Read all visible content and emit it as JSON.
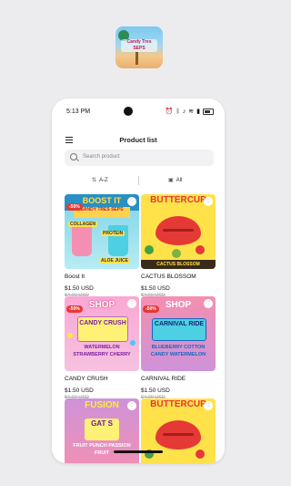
{
  "app_icon": {
    "label": "Candy Tres SEPS"
  },
  "status": {
    "time": "5:13 PM"
  },
  "header": {
    "title": "Product list"
  },
  "search": {
    "placeholder": "Search product"
  },
  "filters": {
    "sort_label": "A-Z",
    "category_label": "All"
  },
  "products": [
    {
      "name": "Boost It",
      "price": "$1.50 USD",
      "old_price": "$4.00 USD",
      "badge": "-50%",
      "art": {
        "header": "BOOST IT",
        "sub": "SANDY TRES SEPS",
        "labels": [
          "COLLAGEN",
          "PROTEIN",
          "ALOE JUICE"
        ]
      }
    },
    {
      "name": "CACTUS BLOSSOM",
      "price": "$1.50 USD",
      "old_price": "$4.00 USD",
      "badge": "",
      "art": {
        "header": "BUTTERCUP",
        "footer": "CACTUS BLOSSOM"
      }
    },
    {
      "name": "CANDY CRUSH",
      "price": "$1.50 USD",
      "old_price": "$4.00 USD",
      "badge": "-50%",
      "art": {
        "header": "SHOP",
        "box": "CANDY CRUSH",
        "flavors": "WATERMELON STRAWBERRY CHERRY"
      }
    },
    {
      "name": "CARNIVAL RIDE",
      "price": "$1.50 USD",
      "old_price": "$4.00 USD",
      "badge": "-50%",
      "art": {
        "header": "SHOP",
        "box": "CARNIVAL RIDE",
        "flavors": "BLUEBERRY COTTON CANDY WATERMELON"
      }
    },
    {
      "name": "",
      "price": "",
      "old_price": "",
      "badge": "",
      "art": {
        "header": "FUSION",
        "box": "GAT S",
        "flavors": "FRUIT PUNCH PASSION FRUIT"
      }
    },
    {
      "name": "",
      "price": "",
      "old_price": "",
      "badge": "",
      "art": {
        "header": "BUTTERCUP"
      }
    }
  ],
  "colors": {
    "background": "#ececee",
    "card_surface": "#ffffff",
    "discount": "#e53935"
  }
}
